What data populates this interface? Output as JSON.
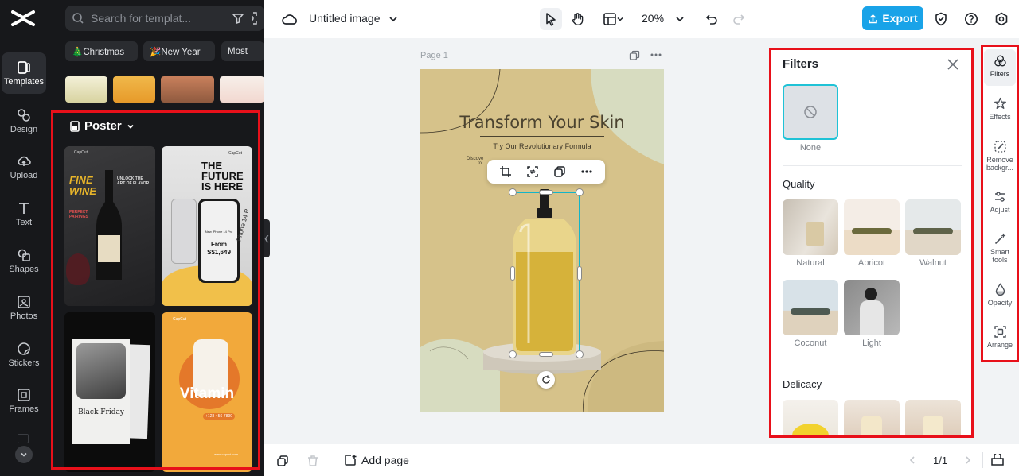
{
  "rail": {
    "items": [
      {
        "label": "Templates",
        "icon": "templates-icon"
      },
      {
        "label": "Design",
        "icon": "design-icon"
      },
      {
        "label": "Upload",
        "icon": "upload-icon"
      },
      {
        "label": "Text",
        "icon": "text-icon"
      },
      {
        "label": "Shapes",
        "icon": "shapes-icon"
      },
      {
        "label": "Photos",
        "icon": "photos-icon"
      },
      {
        "label": "Stickers",
        "icon": "stickers-icon"
      },
      {
        "label": "Frames",
        "icon": "frames-icon"
      }
    ]
  },
  "templates_panel": {
    "search_placeholder": "Search for templat...",
    "chips": [
      "🎄Christmas",
      "🎉New Year",
      "Most"
    ],
    "section_title": "Poster",
    "cards": [
      {
        "brand": "CapCut",
        "headline": "FINE WINE",
        "subline": "UNLOCK THE ART OF FLAVOR",
        "tag": "PERFECT PAIRINGS"
      },
      {
        "brand": "CapCut",
        "headline": "THE FUTURE IS HERE",
        "product": "New iPhone 14 Pro",
        "price_label": "From",
        "price": "S$1,649",
        "side_text": "iPhone 14 P"
      },
      {
        "brand": "",
        "headline": "Black Friday"
      },
      {
        "brand": "CapCut",
        "headline": "Vitamin",
        "phone": "+123-456-7890",
        "site": "www.capcut.com"
      }
    ]
  },
  "topbar": {
    "title": "Untitled image",
    "zoom": "20%",
    "export_label": "Export"
  },
  "canvas": {
    "page_label": "Page 1",
    "poster_title": "Transform Your Skin",
    "poster_subtitle": "Try Our Revolutionary Formula",
    "poster_small_1": "Discove",
    "poster_small_2": "fo"
  },
  "bottombar": {
    "add_page_label": "Add page",
    "page_count": "1/1"
  },
  "filters": {
    "title": "Filters",
    "none_label": "None",
    "sections": [
      {
        "title": "Quality",
        "items": [
          "Natural",
          "Apricot",
          "Walnut",
          "Coconut",
          "Light"
        ]
      },
      {
        "title": "Delicacy",
        "items": []
      }
    ]
  },
  "right_tools": [
    {
      "label": "Filters",
      "icon": "filters-icon"
    },
    {
      "label": "Effects",
      "icon": "effects-icon"
    },
    {
      "label": "Remove backgr...",
      "icon": "remove-background-icon"
    },
    {
      "label": "Adjust",
      "icon": "adjust-icon"
    },
    {
      "label": "Smart tools",
      "icon": "smart-tools-icon"
    },
    {
      "label": "Opacity",
      "icon": "opacity-icon"
    },
    {
      "label": "Arrange",
      "icon": "arrange-icon"
    }
  ],
  "colors": {
    "accent": "#19a3e8",
    "highlight_box": "#e8101a",
    "dark_panel": "#17181b",
    "poster_bg": "#d6c28a"
  }
}
